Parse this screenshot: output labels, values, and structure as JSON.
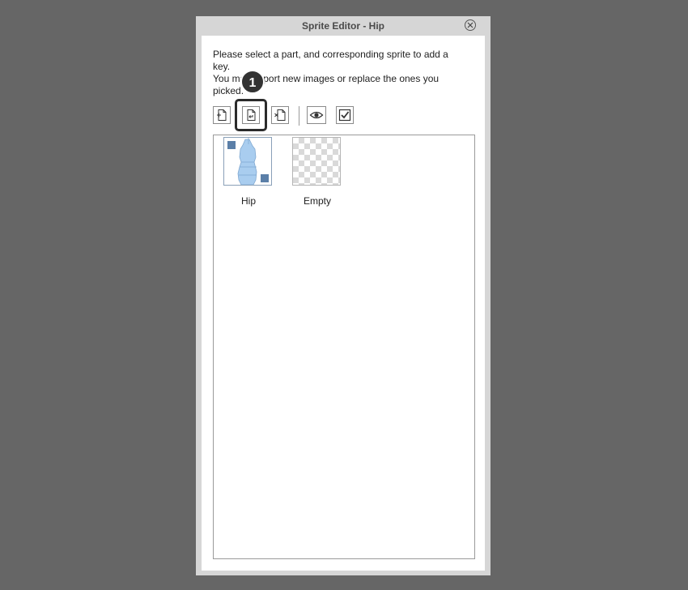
{
  "window": {
    "title": "Sprite Editor - Hip"
  },
  "instructions": {
    "line1": "Please select a part, and corresponding sprite to add a",
    "line2": "key.",
    "line3": "You may import new images or replace the ones you",
    "line4": "picked."
  },
  "toolbar": {
    "buttons": [
      {
        "icon": "add-file-icon",
        "tooltip": ""
      },
      {
        "icon": "replace-file-icon",
        "tooltip": ""
      },
      {
        "icon": "delete-file-icon",
        "tooltip": ""
      },
      {
        "icon": "eye-icon",
        "tooltip": ""
      },
      {
        "icon": "checkbox-icon",
        "tooltip": ""
      }
    ]
  },
  "annotation": {
    "step": "1"
  },
  "sprites": [
    {
      "label": "Hip",
      "selected": true
    },
    {
      "label": "Empty",
      "selected": false
    }
  ],
  "colors": {
    "background": "#666666",
    "dialog": "#d6d6d6",
    "accent": "#5b7fa8",
    "sprite_fill": "#a9cdef"
  }
}
